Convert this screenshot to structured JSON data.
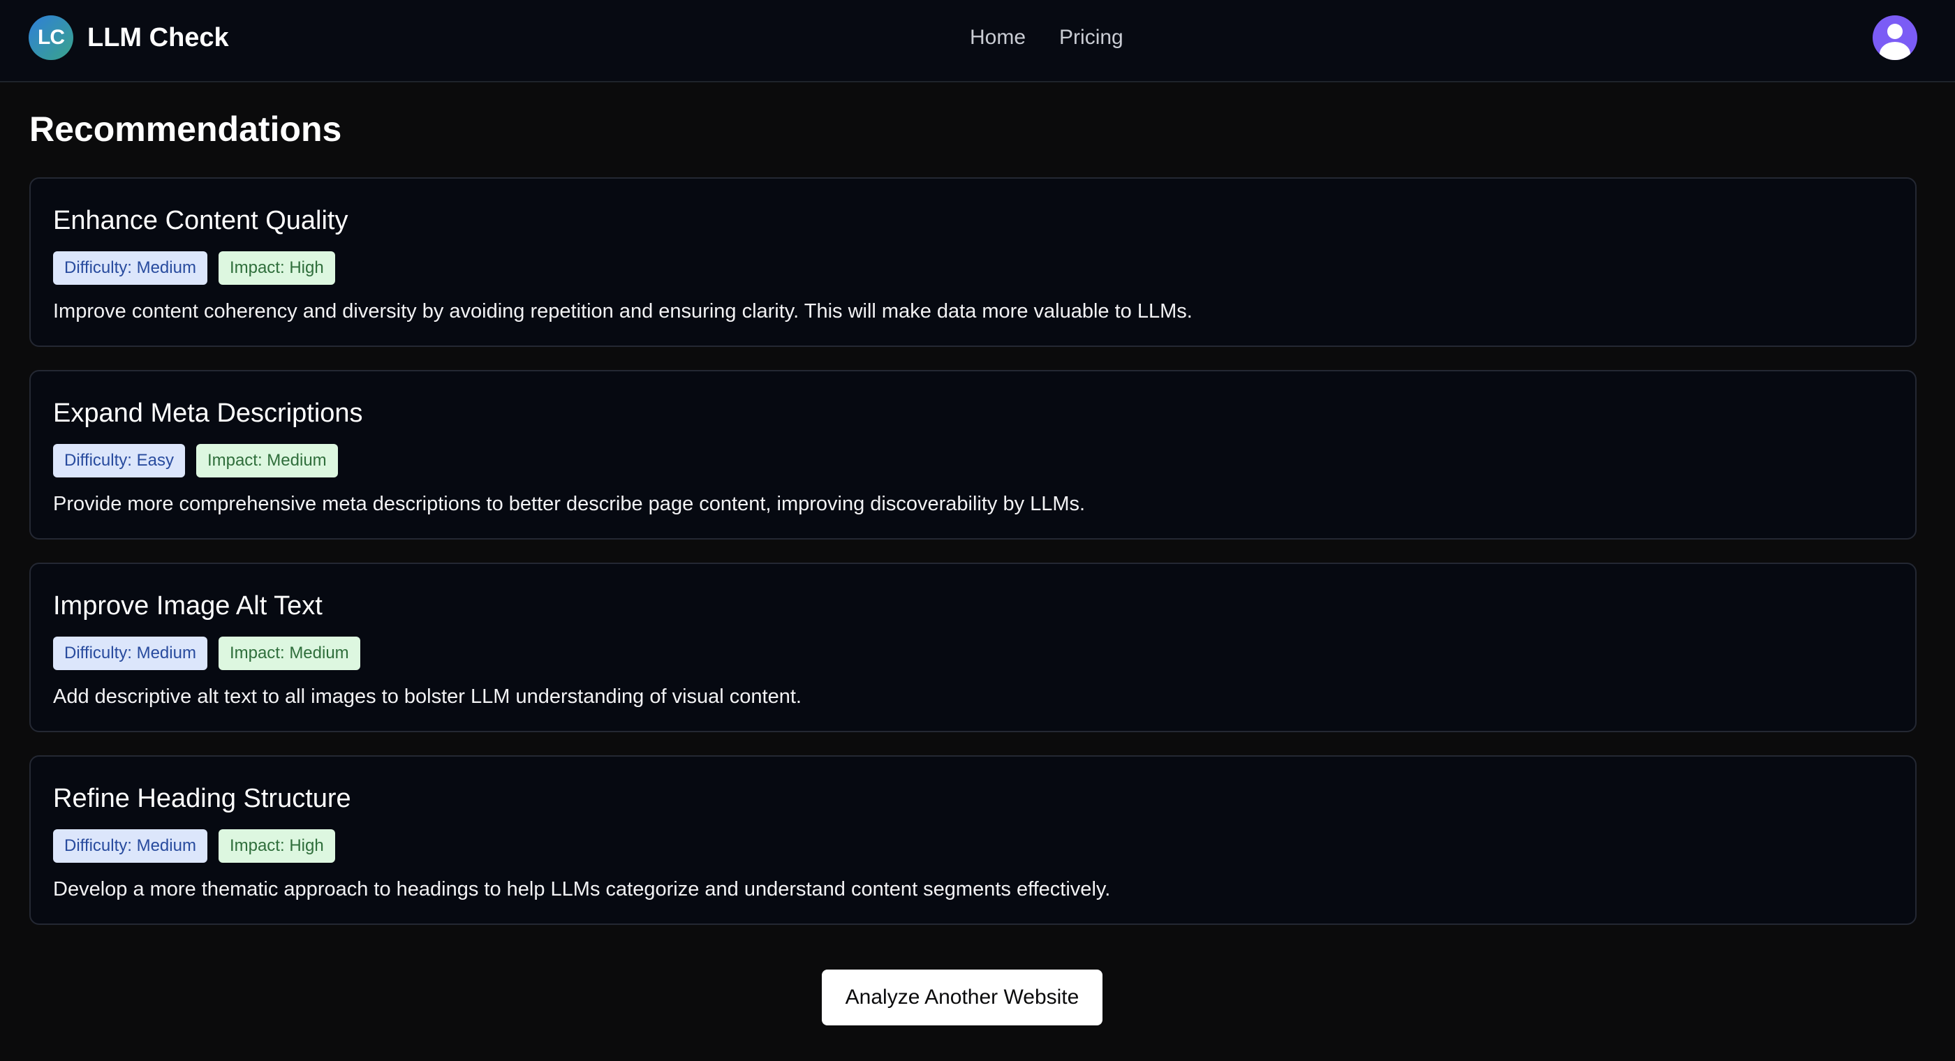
{
  "header": {
    "logo_text": "LC",
    "app_name": "LLM Check",
    "nav": [
      {
        "label": "Home"
      },
      {
        "label": "Pricing"
      }
    ],
    "avatar_icon": "user-avatar-icon"
  },
  "main": {
    "section_title": "Recommendations",
    "recommendations": [
      {
        "title": "Enhance Content Quality",
        "difficulty": "Difficulty: Medium",
        "impact": "Impact: High",
        "description": "Improve content coherency and diversity by avoiding repetition and ensuring clarity. This will make data more valuable to LLMs."
      },
      {
        "title": "Expand Meta Descriptions",
        "difficulty": "Difficulty: Easy",
        "impact": "Impact: Medium",
        "description": "Provide more comprehensive meta descriptions to better describe page content, improving discoverability by LLMs."
      },
      {
        "title": "Improve Image Alt Text",
        "difficulty": "Difficulty: Medium",
        "impact": "Impact: Medium",
        "description": "Add descriptive alt text to all images to bolster LLM understanding of visual content."
      },
      {
        "title": "Refine Heading Structure",
        "difficulty": "Difficulty: Medium",
        "impact": "Impact: High",
        "description": "Develop a more thematic approach to headings to help LLMs categorize and understand content segments effectively."
      }
    ],
    "action_button_label": "Analyze Another Website"
  },
  "colors": {
    "background": "#0b0b0c",
    "card_background": "#060911",
    "difficulty_badge_bg": "#dce6fb",
    "difficulty_badge_text": "#284b9e",
    "impact_badge_bg": "#ddf7e0",
    "impact_badge_text": "#2f6e3b",
    "avatar": "#7b5cf5"
  }
}
